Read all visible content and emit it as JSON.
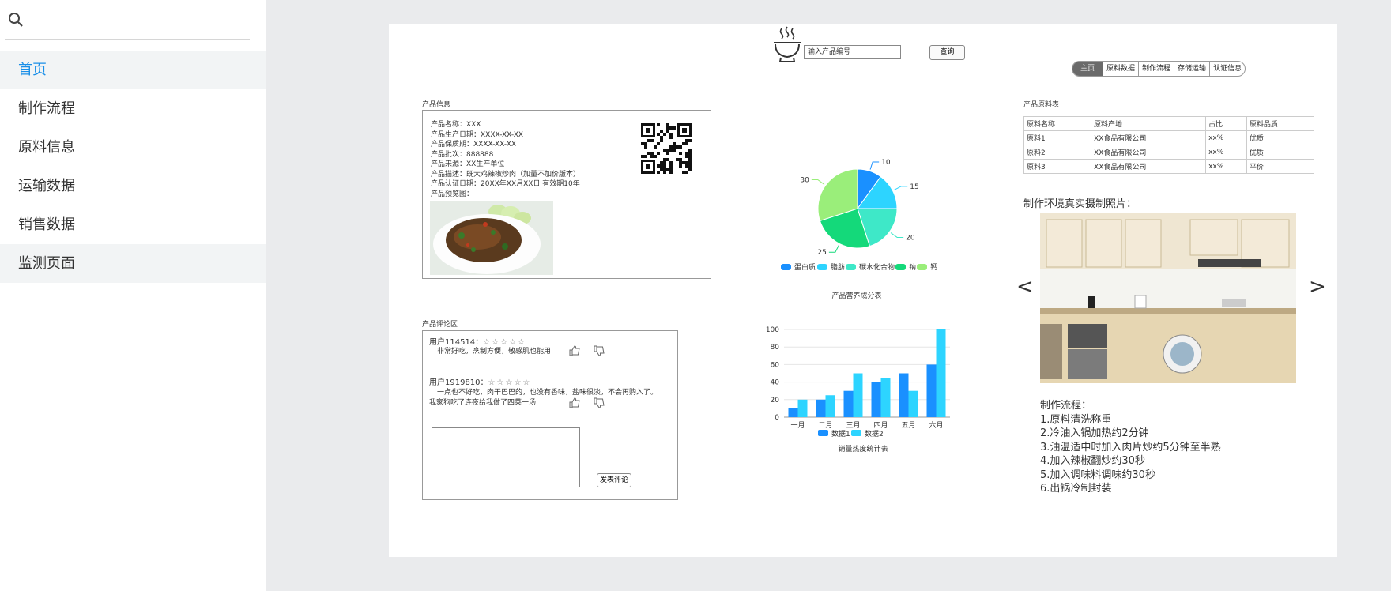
{
  "sidebar": {
    "search_icon": "search-icon",
    "items": [
      "首页",
      "制作流程",
      "原料信息",
      "运输数据",
      "销售数据",
      "监测页面"
    ]
  },
  "header": {
    "input_placeholder": "输入产品编号",
    "query_label": "查询",
    "tabs": [
      "主页",
      "原料数据",
      "制作流程",
      "存储运输",
      "认证信息"
    ]
  },
  "product": {
    "title": "产品信息",
    "lines": [
      "产品名称：XXX",
      "产品生产日期：XXXX-XX-XX",
      "产品保质期：XXXX-XX-XX",
      "产品批次：888888",
      "产品来源：XX生产单位",
      "产品描述：既大鸡辣椒炒肉（加量不加价版本）",
      "产品认证日期：20XX年XX月XX日 有效期10年",
      "产品预览图："
    ]
  },
  "comments": {
    "title": "产品评论区",
    "items": [
      {
        "user": "用户114514：",
        "stars": "☆☆☆☆☆",
        "text_lines": [
          "非常好吃，烹制方便，敬感肌也能用"
        ]
      },
      {
        "user": "用户1919810：",
        "stars": "☆☆☆☆☆",
        "text_lines": [
          "一点也不好吃，肉干巴巴的，也没有香味，盐味很淡，不会再购入了。",
          "我家狗吃了连夜给我做了四菜一汤"
        ]
      }
    ],
    "submit_label": "发表评论"
  },
  "chart_data": [
    {
      "type": "pie",
      "title": "产品营养成分表",
      "labels": [
        "蛋白质",
        "脂肪",
        "碳水化合物",
        "钠",
        "钙"
      ],
      "values": [
        10,
        15,
        20,
        25,
        30
      ],
      "colors": [
        "#1a90ff",
        "#2dd4ff",
        "#3ee8c8",
        "#14d97a",
        "#9aee7a"
      ]
    },
    {
      "type": "bar",
      "title": "销量热度统计表",
      "categories": [
        "一月",
        "二月",
        "三月",
        "四月",
        "五月",
        "六月"
      ],
      "series": [
        {
          "name": "数据1",
          "values": [
            10,
            20,
            30,
            40,
            50,
            60
          ],
          "color": "#1a90ff"
        },
        {
          "name": "数据2",
          "values": [
            20,
            25,
            50,
            45,
            30,
            100
          ],
          "color": "#2dd4ff"
        }
      ],
      "ylim": [
        0,
        100
      ],
      "yticks": [
        0,
        20,
        40,
        60,
        80,
        100
      ]
    }
  ],
  "raw_table": {
    "title": "产品原料表",
    "headers": [
      "原料名称",
      "原料产地",
      "占比",
      "原料品质"
    ],
    "rows": [
      [
        "原料1",
        "XX食品有限公司",
        "xx%",
        "优质"
      ],
      [
        "原料2",
        "XX食品有限公司",
        "xx%",
        "优质"
      ],
      [
        "原料3",
        "XX食品有限公司",
        "xx%",
        "平价"
      ]
    ]
  },
  "environment": {
    "title": "制作环境真实摄制照片：",
    "prev": "<",
    "next": ">"
  },
  "process": {
    "title": "制作流程：",
    "steps": [
      "1.原料清洗称重",
      "2.冷油入锅加热约2分钟",
      "3.油温适中时加入肉片炒约5分钟至半熟",
      "4.加入辣椒翻炒约30秒",
      "5.加入调味料调味约30秒",
      "6.出锅冷制封装"
    ]
  }
}
